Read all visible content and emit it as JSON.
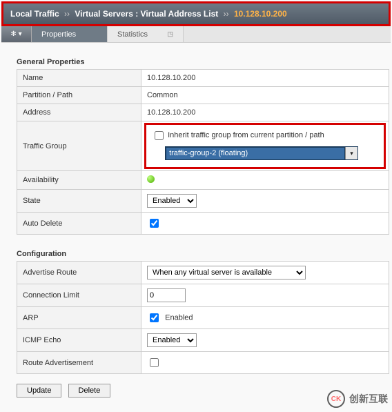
{
  "breadcrumb": {
    "part1": "Local Traffic",
    "part2": "Virtual Servers : Virtual Address List",
    "active": "10.128.10.200"
  },
  "gear_label": "✻ ▾",
  "tabs": [
    {
      "label": "Properties",
      "active": true
    },
    {
      "label": "Statistics",
      "active": false
    }
  ],
  "sections": {
    "general_title": "General Properties",
    "config_title": "Configuration"
  },
  "general": {
    "name_label": "Name",
    "name_value": "10.128.10.200",
    "partition_label": "Partition / Path",
    "partition_value": "Common",
    "address_label": "Address",
    "address_value": "10.128.10.200",
    "traffic_group_label": "Traffic Group",
    "inherit_checkbox_label": "Inherit traffic group from current partition / path",
    "inherit_checked": false,
    "traffic_group_select": "traffic-group-2 (floating)",
    "availability_label": "Availability",
    "state_label": "State",
    "state_select": "Enabled",
    "auto_delete_label": "Auto Delete",
    "auto_delete_checked": true
  },
  "config": {
    "advertise_route_label": "Advertise Route",
    "advertise_route_select": "When any virtual server is available",
    "conn_limit_label": "Connection Limit",
    "conn_limit_value": "0",
    "arp_label": "ARP",
    "arp_checked": true,
    "arp_text": "Enabled",
    "icmp_label": "ICMP Echo",
    "icmp_select": "Enabled",
    "route_adv_label": "Route Advertisement",
    "route_adv_checked": false
  },
  "buttons": {
    "update": "Update",
    "delete": "Delete"
  },
  "watermark": {
    "logo": "CK",
    "text": "创新互联"
  }
}
